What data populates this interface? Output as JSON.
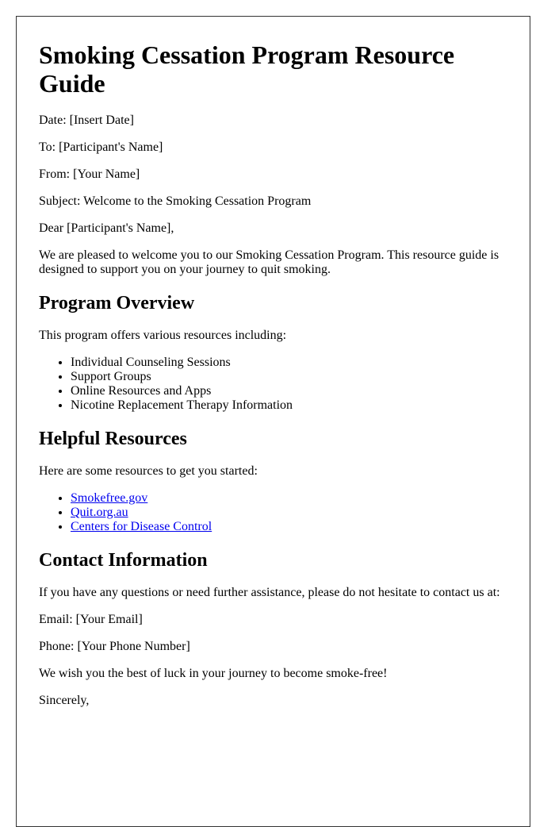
{
  "title": "Smoking Cessation Program Resource Guide",
  "header": {
    "date": "Date: [Insert Date]",
    "to": "To: [Participant's Name]",
    "from": "From: [Your Name]",
    "subject": "Subject: Welcome to the Smoking Cessation Program"
  },
  "salutation": "Dear [Participant's Name],",
  "intro": "We are pleased to welcome you to our Smoking Cessation Program. This resource guide is designed to support you on your journey to quit smoking.",
  "sections": {
    "overview": {
      "heading": "Program Overview",
      "intro": "This program offers various resources including:",
      "items": [
        "Individual Counseling Sessions",
        "Support Groups",
        "Online Resources and Apps",
        "Nicotine Replacement Therapy Information"
      ]
    },
    "resources": {
      "heading": "Helpful Resources",
      "intro": "Here are some resources to get you started:",
      "links": [
        "Smokefree.gov",
        "Quit.org.au",
        "Centers for Disease Control"
      ],
      "link_color": "#0000ee"
    },
    "contact": {
      "heading": "Contact Information",
      "intro": "If you have any questions or need further assistance, please do not hesitate to contact us at:",
      "email": "Email: [Your Email]",
      "phone": "Phone: [Your Phone Number]"
    }
  },
  "closing": {
    "wish": "We wish you the best of luck in your journey to become smoke-free!",
    "signoff": "Sincerely,"
  }
}
